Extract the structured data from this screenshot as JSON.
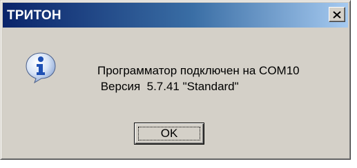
{
  "window": {
    "title": "ТРИТОН"
  },
  "titlebar": {
    "close_icon": "close-icon"
  },
  "dialog": {
    "icon": "info-icon",
    "message_line1": "Программатор подключен на COM10",
    "message_line2": " Версия  5.7.41 \"Standard\""
  },
  "buttons": {
    "ok_label": "OK"
  },
  "colors": {
    "face": "#d4d0c8",
    "title_start": "#0a246a",
    "title_end": "#a6caf0",
    "icon_blue": "#1e50b4"
  }
}
